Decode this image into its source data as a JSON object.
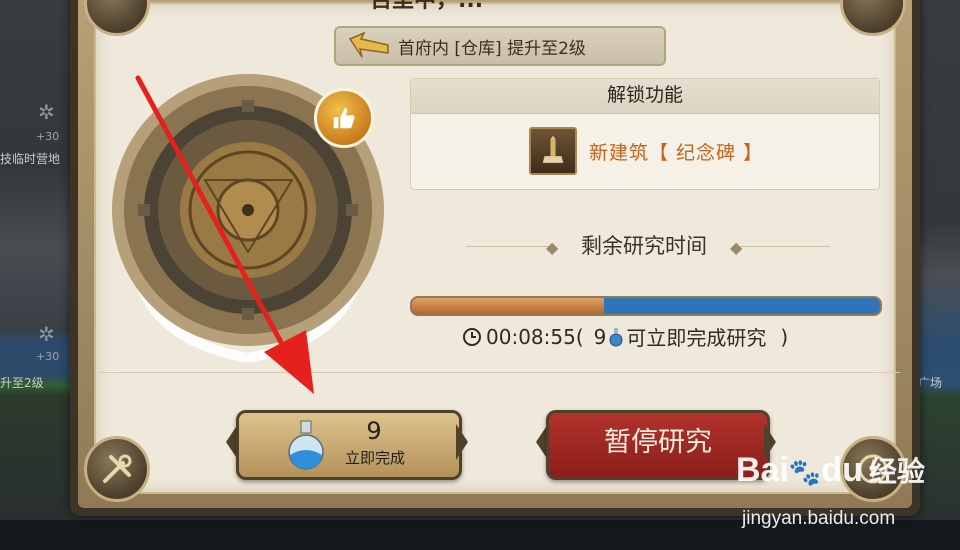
{
  "background": {
    "left_labels": [
      "技临时营地",
      "升至2级"
    ],
    "left_numbers": [
      "+30",
      "+30"
    ],
    "right_labels": [
      "广场"
    ]
  },
  "dialog": {
    "title_partial": "百里中，...",
    "banner_text": "首府内 [仓库] 提升至2级",
    "unlock": {
      "heading": "解锁功能",
      "item_label": "新建筑【 纪念碑 】",
      "item_icon": "monument-icon"
    },
    "remaining": {
      "title": "剩余研究时间",
      "progress_fraction": 0.41,
      "time": "00:08:55",
      "paren_open": "(",
      "potion_count": "9",
      "suffix": "可立即完成研究",
      "paren_close": ")"
    },
    "buttons": {
      "complete_count": "9",
      "complete_label": "立即完成",
      "pause_label": "暂停研究"
    }
  },
  "watermark": {
    "logo": "Bai",
    "logo_tail": "du",
    "logo_cn": "经验",
    "url": "jingyan.baidu.com"
  },
  "colors": {
    "accent_orange": "#c4631b",
    "progress_done": "#b4652c",
    "progress_rest": "#2a6bb1",
    "pause_red": "#a42a24",
    "annotation_red": "#e5211d"
  }
}
